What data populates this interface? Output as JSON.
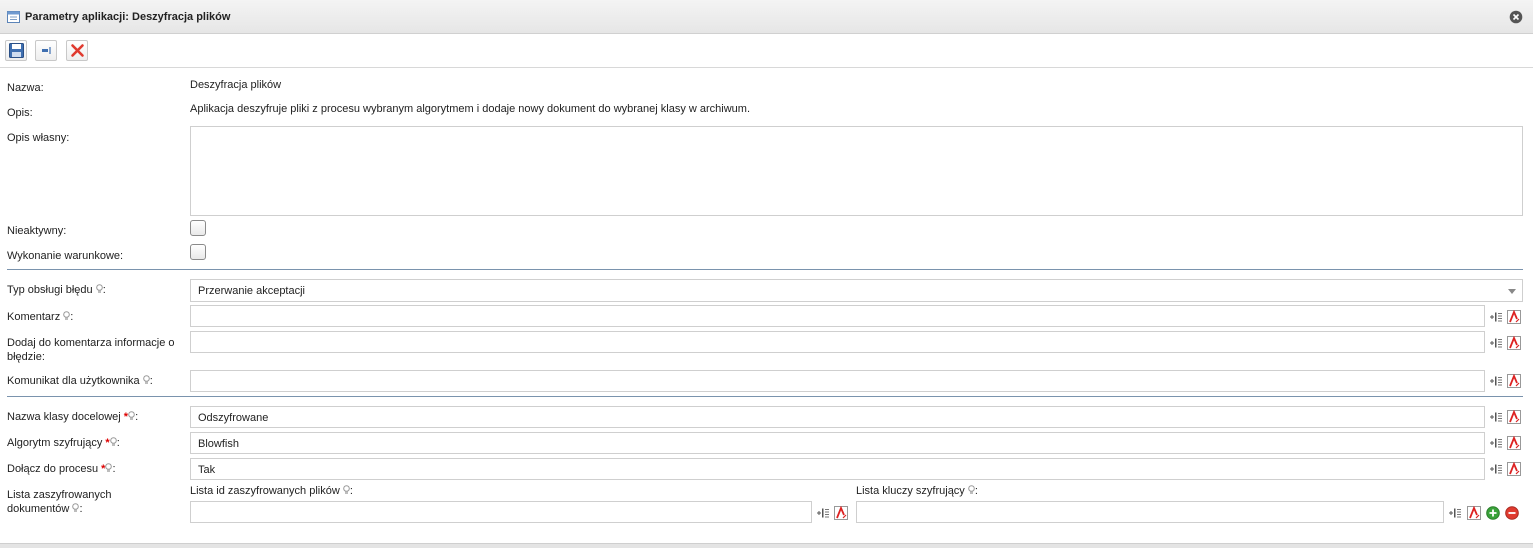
{
  "window": {
    "title": "Parametry aplikacji: Deszyfracja plików"
  },
  "toolbar": {
    "save_icon": "save-icon",
    "compact_icon": "compact-view-icon",
    "delete_icon": "delete-icon"
  },
  "form": {
    "name_label": "Nazwa:",
    "name_value": "Deszyfracja plików",
    "desc_label": "Opis:",
    "desc_value": "Aplikacja deszyfruje pliki z procesu wybranym algorytmem i dodaje nowy dokument do wybranej klasy w archiwum.",
    "own_desc_label": "Opis własny:",
    "own_desc_value": "",
    "inactive_label": "Nieaktywny:",
    "conditional_label": "Wykonanie warunkowe:",
    "error_type_label": "Typ obsługi błędu",
    "error_type_value": "Przerwanie akceptacji",
    "comment_label": "Komentarz",
    "comment_value": "",
    "add_info_label": "Dodaj do komentarza informacje o błędzie:",
    "add_info_value": "",
    "user_msg_label": "Komunikat dla użytkownika",
    "user_msg_value": "",
    "target_class_label": "Nazwa klasy docelowej",
    "target_class_value": "Odszyfrowane",
    "algorithm_label": "Algorytm szyfrujący",
    "algorithm_value": "Blowfish",
    "attach_label": "Dołącz do procesu",
    "attach_value": "Tak",
    "encrypted_list_label": "Lista zaszyfrowanych dokumentów",
    "ids_list_label": "Lista id zaszyfrowanych plików",
    "keys_list_label": "Lista kluczy szyfrujący",
    "colon": ":",
    "required_mark": "*"
  },
  "colors": {
    "separator": "#7a93ad",
    "required": "#dd0000",
    "delete_red": "#e03a2f",
    "add_green": "#3aa23a"
  }
}
